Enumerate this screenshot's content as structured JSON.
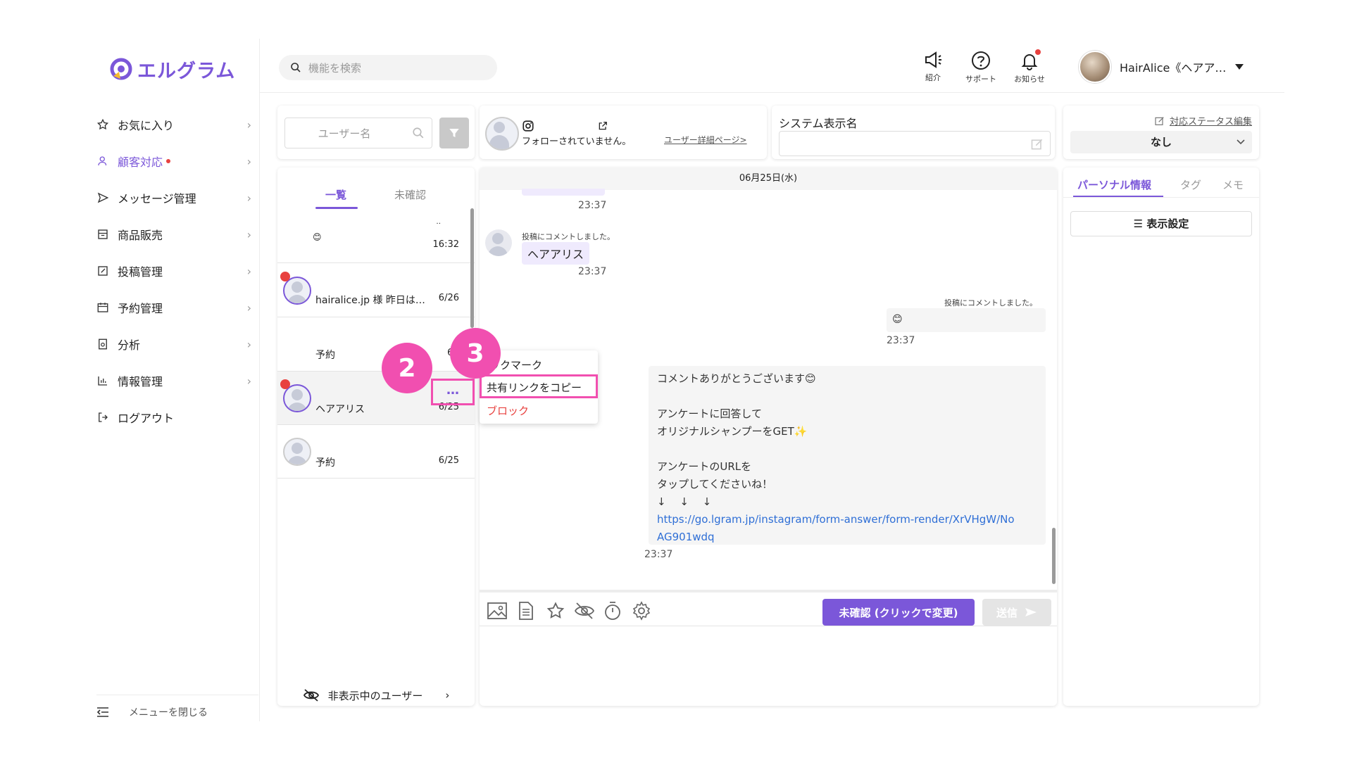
{
  "app": {
    "name": "エルグラム",
    "brand_color": "#7b57d9"
  },
  "sidebar": {
    "items": [
      {
        "label": "お気に入り",
        "icon": "star-icon"
      },
      {
        "label": "顧客対応",
        "icon": "person-icon",
        "active": true,
        "badge": "red-dot"
      },
      {
        "label": "メッセージ管理",
        "icon": "send-icon"
      },
      {
        "label": "商品販売",
        "icon": "store-icon"
      },
      {
        "label": "投稿管理",
        "icon": "edit-icon"
      },
      {
        "label": "予約管理",
        "icon": "calendar-icon"
      },
      {
        "label": "分析",
        "icon": "report-icon"
      },
      {
        "label": "情報管理",
        "icon": "chart-icon"
      },
      {
        "label": "ログアウト",
        "icon": "logout-icon"
      }
    ],
    "close_menu": "メニューを閉じる"
  },
  "header": {
    "search_placeholder": "機能を検索",
    "icons": [
      {
        "label": "紹介",
        "icon": "megaphone-icon"
      },
      {
        "label": "サポート",
        "icon": "help-icon"
      },
      {
        "label": "お知らせ",
        "icon": "bell-icon"
      }
    ],
    "account_name": "HairAlice《ヘアア…"
  },
  "user_list": {
    "search_placeholder": "ユーザー名",
    "tabs": [
      "一覧",
      "未確認"
    ],
    "rows": [
      {
        "name": "😊",
        "extra": "‥",
        "date": "16:32"
      },
      {
        "name": "hairalice.jp 様 昨日は…",
        "date": "6/26"
      },
      {
        "name": "予約",
        "date": "6/2"
      },
      {
        "name": "ヘアアリス",
        "date": "6/25",
        "more": "…"
      },
      {
        "name": "予約",
        "date": "6/25"
      }
    ],
    "hidden_users": "非表示中のユーザー"
  },
  "chat_header": {
    "follow_status": "フォローされていません。",
    "detail_link": "ユーザー詳細ページ>",
    "system_name_label": "システム表示名"
  },
  "chat": {
    "date": "06月25日(水)",
    "messages": [
      {
        "time": "23:37"
      },
      {
        "note": "投稿にコメントしました。",
        "text": "ヘアアリス",
        "time": "23:37"
      },
      {
        "note": "投稿にコメントしました。",
        "text": "😊",
        "time": "23:37"
      },
      {
        "lines": [
          "コメントありがとうございます😊",
          "",
          "アンケートに回答して",
          "オリジナルシャンプーをGET✨",
          "",
          "アンケートのURLを",
          "タップしてくださいね！",
          "↓　 ↓ 　↓"
        ],
        "link_line1": "https://go.lgram.jp/instagram/form-answer/form-render/XrVHgW/No",
        "link_line2": "AG901wdq",
        "time": "23:37"
      }
    ],
    "unconfirmed_button": "未確認 (クリックで変更)",
    "send_button": "送信"
  },
  "context_menu": {
    "items": [
      "ックマーク",
      "共有リンクをコピー",
      "ブロック"
    ]
  },
  "steps": [
    "2",
    "3"
  ],
  "status": {
    "edit_label": "対応ステータス編集",
    "value": "なし"
  },
  "info_panel": {
    "tabs": [
      "パーソナル情報",
      "タグ",
      "メモ"
    ],
    "display_settings": "表示設定"
  }
}
